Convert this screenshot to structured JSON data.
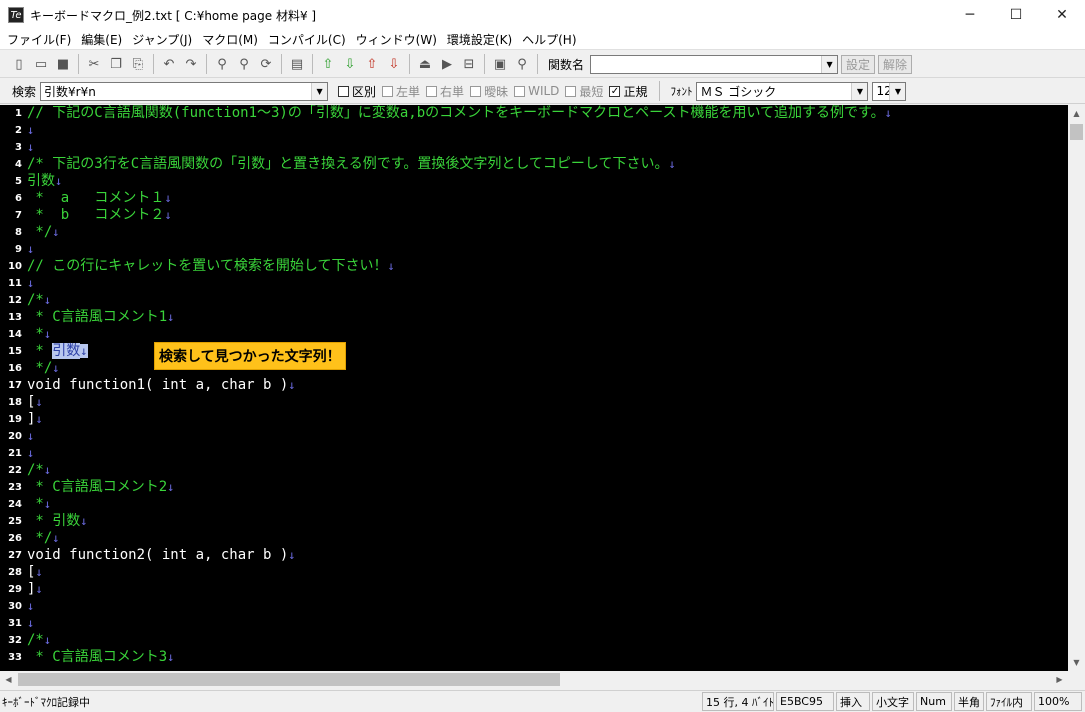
{
  "window": {
    "title": "キーボードマクロ_例2.txt [ C:¥home page 材料¥ ]",
    "icon_letter": "Te",
    "minimize": "─",
    "maximize": "☐",
    "close": "✕"
  },
  "menu": [
    "ファイル(F)",
    "編集(E)",
    "ジャンプ(J)",
    "マクロ(M)",
    "コンパイル(C)",
    "ウィンドウ(W)",
    "環境設定(K)",
    "ヘルプ(H)"
  ],
  "toolbar": {
    "function_label": "関数名",
    "function_value": "",
    "set_button": "設定",
    "release_button": "解除"
  },
  "search_bar": {
    "label": "検索",
    "value": "引数¥r¥n",
    "options": [
      {
        "label": "区別",
        "checked": false,
        "enabled": true
      },
      {
        "label": "左単",
        "checked": false,
        "enabled": false
      },
      {
        "label": "右単",
        "checked": false,
        "enabled": false
      },
      {
        "label": "曖昧",
        "checked": false,
        "enabled": false
      },
      {
        "label": "WILD",
        "checked": false,
        "enabled": false
      },
      {
        "label": "最短",
        "checked": false,
        "enabled": false
      },
      {
        "label": "正規",
        "checked": true,
        "enabled": true
      }
    ],
    "font_label": "ﾌｫﾝﾄ",
    "font_value": "ＭＳ ゴシック",
    "size_value": "12"
  },
  "editor": {
    "eol_mark": "↓",
    "callout": "検索して見つかった文字列！",
    "lines": [
      {
        "n": "1",
        "text": "// 下記のC言語風関数(function1〜3)の「引数」に変数a,bのコメントをキーボードマクロとペースト機能を用いて追加する例です。",
        "style": "green"
      },
      {
        "n": "2",
        "text": "",
        "style": "white"
      },
      {
        "n": "3",
        "text": "",
        "style": "white"
      },
      {
        "n": "4",
        "text": "/* 下記の3行をC言語風関数の「引数」と置き換える例です。置換後文字列としてコピーして下さい。",
        "style": "green"
      },
      {
        "n": "5",
        "text": "引数",
        "style": "green"
      },
      {
        "n": "6",
        "text": " *  a   コメント１",
        "style": "green"
      },
      {
        "n": "7",
        "text": " *  b   コメント２",
        "style": "green"
      },
      {
        "n": "8",
        "text": " */",
        "style": "green"
      },
      {
        "n": "9",
        "text": "",
        "style": "white"
      },
      {
        "n": "10",
        "text": "// この行にキャレットを置いて検索を開始して下さい！",
        "style": "green"
      },
      {
        "n": "11",
        "text": "",
        "style": "white"
      },
      {
        "n": "12",
        "text": "/*",
        "style": "green"
      },
      {
        "n": "13",
        "text": " * C言語風コメント1",
        "style": "green"
      },
      {
        "n": "14",
        "text": " *",
        "style": "green"
      },
      {
        "n": "15",
        "text": " * ",
        "style": "green",
        "highlight": "引数"
      },
      {
        "n": "16",
        "text": " */",
        "style": "green"
      },
      {
        "n": "17",
        "text": "void function1( int a, char b )",
        "style": "white"
      },
      {
        "n": "18",
        "text": "[",
        "style": "white"
      },
      {
        "n": "19",
        "text": "]",
        "style": "white"
      },
      {
        "n": "20",
        "text": "",
        "style": "white"
      },
      {
        "n": "21",
        "text": "",
        "style": "white"
      },
      {
        "n": "22",
        "text": "/*",
        "style": "green"
      },
      {
        "n": "23",
        "text": " * C言語風コメント2",
        "style": "green"
      },
      {
        "n": "24",
        "text": " *",
        "style": "green"
      },
      {
        "n": "25",
        "text": " * 引数",
        "style": "green"
      },
      {
        "n": "26",
        "text": " */",
        "style": "green"
      },
      {
        "n": "27",
        "text": "void function2( int a, char b )",
        "style": "white"
      },
      {
        "n": "28",
        "text": "[",
        "style": "white"
      },
      {
        "n": "29",
        "text": "]",
        "style": "white"
      },
      {
        "n": "30",
        "text": "",
        "style": "white"
      },
      {
        "n": "31",
        "text": "",
        "style": "white"
      },
      {
        "n": "32",
        "text": "/*",
        "style": "green"
      },
      {
        "n": "33",
        "text": " * C言語風コメント3",
        "style": "green"
      }
    ]
  },
  "status": {
    "message": "ｷｰﾎﾞｰﾄﾞﾏｸﾛ記録中",
    "position": "15 行, 4 ﾊﾞｲﾄ",
    "code": "E5BC95",
    "insert": "挿入",
    "case": "小文字",
    "num": "Num",
    "width": "半角",
    "scope": "ﾌｧｲﾙ内",
    "zoom": "100%"
  }
}
